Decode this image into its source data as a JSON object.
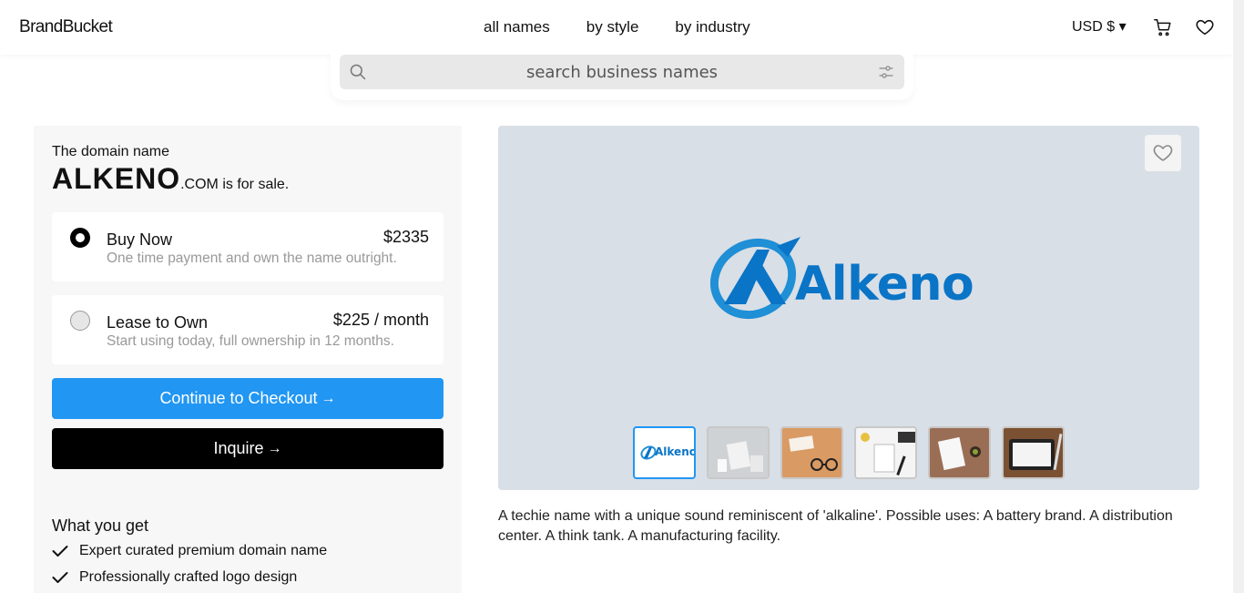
{
  "header": {
    "logo": "BrandBucket",
    "nav": [
      "all names",
      "by style",
      "by industry"
    ],
    "currency": "USD $ ▾",
    "icons": [
      "cart-icon",
      "heart-icon"
    ]
  },
  "search": {
    "placeholder": "search business names"
  },
  "listing": {
    "intro": "The domain name",
    "name": "ALKENO",
    "tld": ".COM",
    "suffix": " is for sale.",
    "options": [
      {
        "title": "Buy Now",
        "price": "$2335",
        "desc": "One time payment and own the name outright.",
        "selected": true
      },
      {
        "title": "Lease to Own",
        "price": "$225 / month",
        "desc": "Start using today, full ownership in 12 months.",
        "selected": false
      }
    ],
    "checkout_label": "Continue to Checkout",
    "inquire_label": "Inquire",
    "arrow": "→",
    "what_you_get_title": "What you get",
    "features": [
      "Expert curated premium domain name",
      "Professionally crafted logo design"
    ]
  },
  "preview": {
    "brand_word": "Alkeno",
    "thumb_brand_word": "Alkeno",
    "thumbnail_count": 6
  },
  "description": "A techie name with a unique sound reminiscent of 'alkaline'. Possible uses: A battery brand. A distribution center. A think tank. A manufacturing facility.",
  "colors": {
    "accent": "#2196f3",
    "brand_blue": "#0a74c6",
    "preview_bg": "#d9dfe6",
    "panel_bg": "#f7f7f7"
  }
}
